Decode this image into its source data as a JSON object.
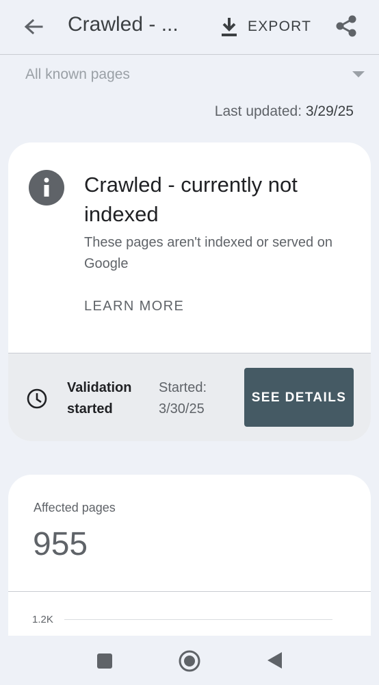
{
  "appbar": {
    "title": "Crawled - ...",
    "export_label": "EXPORT"
  },
  "filter": {
    "selected": "All known pages"
  },
  "last_updated": {
    "label": "Last updated:",
    "value": "3/29/25"
  },
  "status_card": {
    "heading": "Crawled - currently not indexed",
    "description": "These pages aren't indexed or served on Google",
    "learn_more": "LEARN MORE",
    "validation_title": "Validation started",
    "validation_started": "Started: 3/30/25",
    "see_details": "SEE DETAILS"
  },
  "affected": {
    "label": "Affected pages",
    "value": "955",
    "y_tick": "1.2K"
  },
  "icons": [
    "back-arrow-icon",
    "download-icon",
    "share-icon",
    "dropdown-caret-icon",
    "info-icon",
    "clock-icon",
    "nav-recents-icon",
    "nav-home-icon",
    "nav-back-icon"
  ],
  "colors": {
    "background": "#eef1f7",
    "button": "#455a64",
    "text_secondary": "#5f6368"
  }
}
